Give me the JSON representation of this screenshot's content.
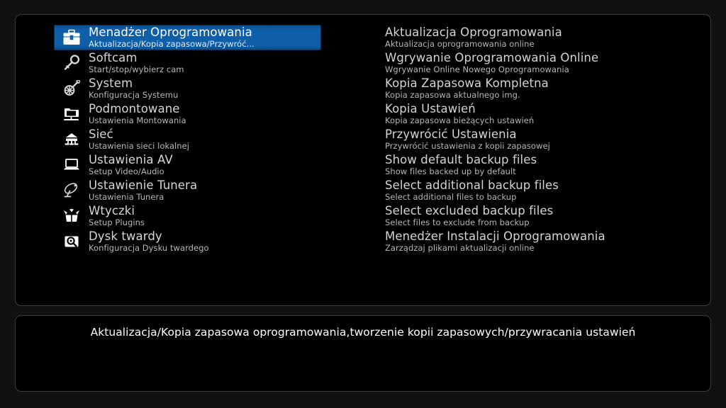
{
  "theme": {
    "panel_background": "#000000",
    "panel_border": "#3a3a3a",
    "selection_color": "#0f5ea8",
    "title_color": "#d6d6d6",
    "subtitle_color": "#b8b8b8",
    "footer_text_color": "#ffffff"
  },
  "menu": {
    "items": [
      {
        "icon": "toolbox-icon",
        "title": "Menadżer Oprogramowania",
        "subtitle": "Aktualizacja/Kopia zapasowa/Przywróć...",
        "selected": true
      },
      {
        "icon": "key-icon",
        "title": "Softcam",
        "subtitle": "Start/stop/wybierz cam",
        "selected": false
      },
      {
        "icon": "gear-screwdriver-icon",
        "title": "System",
        "subtitle": "Konfiguracja Systemu",
        "selected": false
      },
      {
        "icon": "network-folder-icon",
        "title": "Podmontowane",
        "subtitle": "Ustawienia Montowania",
        "selected": false
      },
      {
        "icon": "network-hub-icon",
        "title": "Sieć",
        "subtitle": "Ustawienia sieci lokalnej",
        "selected": false
      },
      {
        "icon": "laptop-icon",
        "title": "Ustawienia AV",
        "subtitle": "Setup Video/Audio",
        "selected": false
      },
      {
        "icon": "satellite-dish-icon",
        "title": "Ustawienie Tunera",
        "subtitle": "Ustawienia Tunera",
        "selected": false
      },
      {
        "icon": "open-box-icon",
        "title": "Wtyczki",
        "subtitle": "Setup Plugins",
        "selected": false
      },
      {
        "icon": "harddisk-icon",
        "title": "Dysk twardy",
        "subtitle": "Konfiguracja Dysku twardego",
        "selected": false
      }
    ]
  },
  "submenu": {
    "items": [
      {
        "title": "Aktualizacja Oprogramowania",
        "subtitle": "Aktualizacja oprogramowania online"
      },
      {
        "title": "Wgrywanie Oprogramowania Online",
        "subtitle": "Wgrywanie Online Nowego Oprogramowania"
      },
      {
        "title": "Kopia Zapasowa Kompletna",
        "subtitle": "Kopia zapasowa aktualnego img."
      },
      {
        "title": "Kopia Ustawień",
        "subtitle": "Kopia zapasowa bieżących ustawień"
      },
      {
        "title": "Przywrócić Ustawienia",
        "subtitle": "Przywrócić ustawienia z kopii zapasowej"
      },
      {
        "title": "Show default backup files",
        "subtitle": "Show files backed up by default"
      },
      {
        "title": "Select additional backup files",
        "subtitle": "Select additional files to backup"
      },
      {
        "title": "Select excluded backup files",
        "subtitle": "Select files to exclude from backup"
      },
      {
        "title": "Menedżer Instalacji Oprogramowania",
        "subtitle": "Zarządzaj plikami aktualizacji online"
      }
    ]
  },
  "footer": {
    "description": "Aktualizacja/Kopia zapasowa oprogramowania,tworzenie kopii zapasowych/przywracania ustawień"
  }
}
